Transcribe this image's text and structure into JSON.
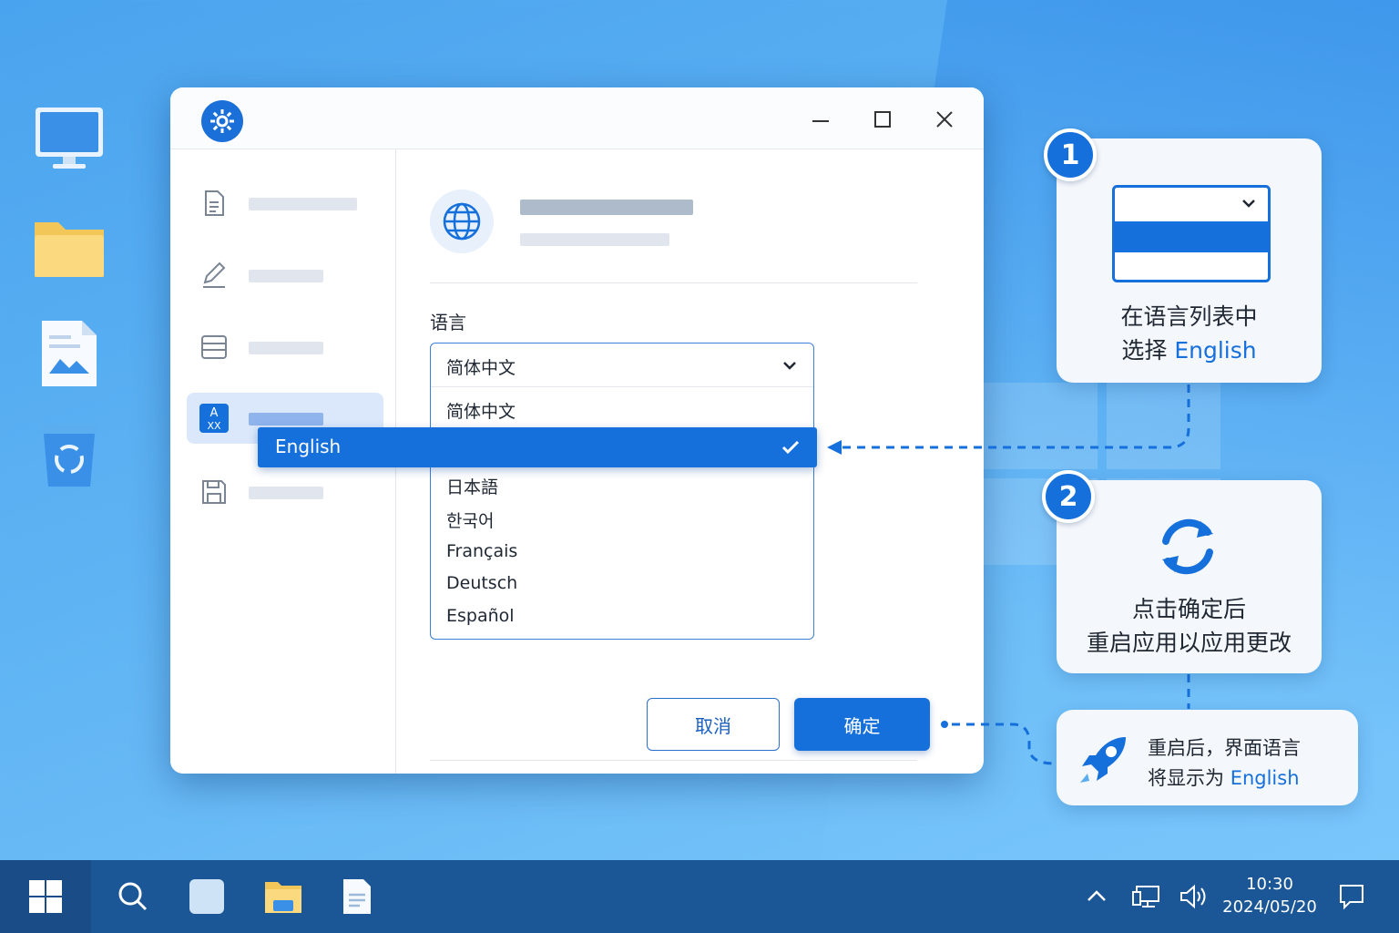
{
  "window": {
    "language_label": "语言",
    "dropdown": {
      "selected_value": "简体中文",
      "options": [
        "简体中文",
        "English",
        "日本語",
        "한국어",
        "Français",
        "Deutsch",
        "Español"
      ],
      "highlighted": "English"
    },
    "cancel_label": "取消",
    "ok_label": "确定"
  },
  "callouts": {
    "step1": {
      "badge": "1",
      "line1": "在语言列表中",
      "line2_prefix": "选择 ",
      "line2_accent": "English"
    },
    "step2": {
      "badge": "2",
      "line1": "点击确定后",
      "line2": "重启应用以应用更改"
    },
    "result": {
      "line1": "重启后，界面语言",
      "line2_prefix": "将显示为 ",
      "line2_accent": "English"
    }
  },
  "taskbar": {
    "time": "10:30",
    "date": "2024/05/20"
  },
  "colors": {
    "accent": "#1670db",
    "taskbar": "#1b5796"
  },
  "icons": [
    "gear-icon",
    "globe-icon",
    "translate-icon",
    "sync-icon",
    "rocket-icon",
    "search-icon",
    "folder-icon"
  ]
}
